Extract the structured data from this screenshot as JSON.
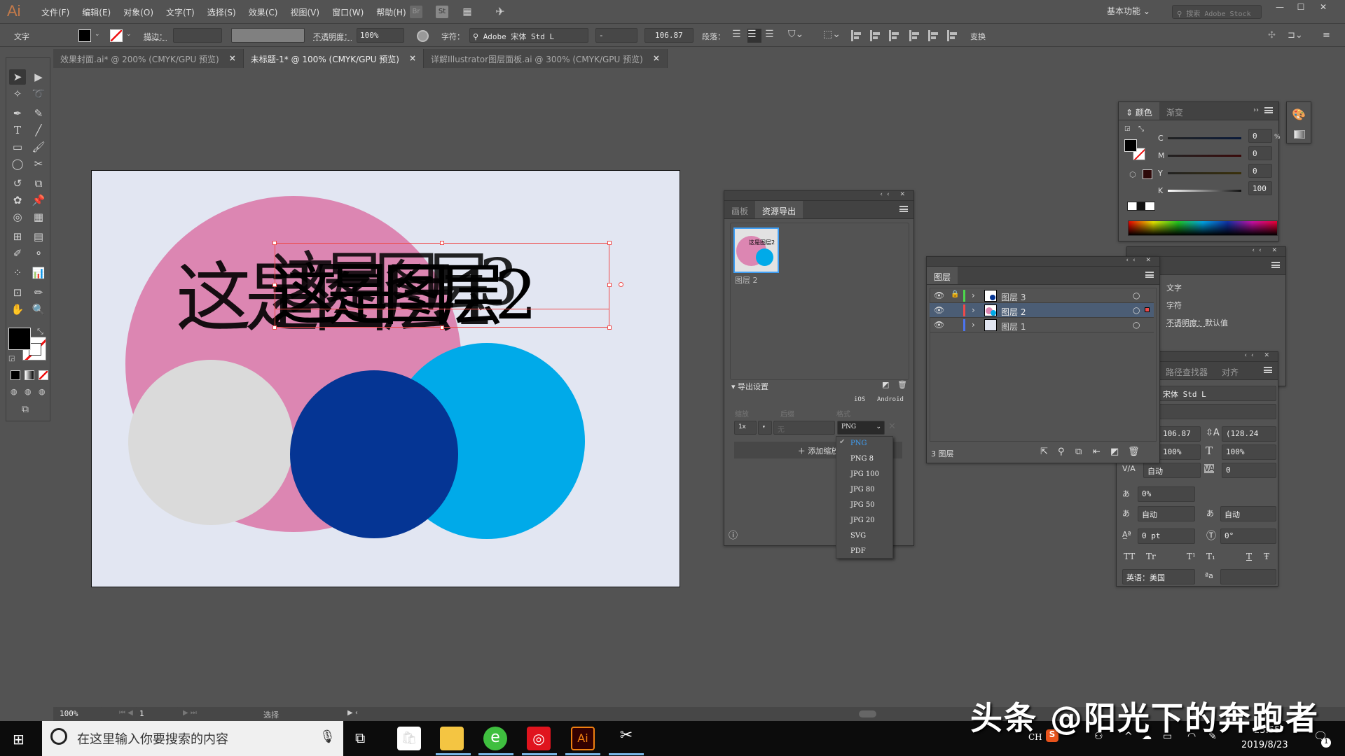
{
  "app": {
    "logo": "Ai",
    "menus": [
      "文件(F)",
      "编辑(E)",
      "对象(O)",
      "文字(T)",
      "选择(S)",
      "效果(C)",
      "视图(V)",
      "窗口(W)",
      "帮助(H)"
    ],
    "bridge_label": "Br",
    "stock_label": "St",
    "workspace": "基本功能",
    "stock_search_placeholder": "搜索 Adobe Stock",
    "window_controls": {
      "minimize": "—",
      "maximize": "☐",
      "close": "✕"
    }
  },
  "control_bar": {
    "tool_name": "文字",
    "stroke_label": "描边：",
    "opacity_label": "不透明度：",
    "opacity_value": "100%",
    "character_label": "字符：",
    "font_family": "Adobe 宋体 Std L",
    "font_style": "-",
    "font_size": "106.87",
    "paragraph_label": "段落：",
    "transform_label": "变换"
  },
  "tabs": [
    {
      "label": "效果封面.ai* @ 200% (CMYK/GPU 预览)",
      "active": false
    },
    {
      "label": "未标题-1* @ 100% (CMYK/GPU 预览)",
      "active": true
    },
    {
      "label": "详解Illustrator图层面板.ai @ 300% (CMYK/GPU 预览)",
      "active": false
    }
  ],
  "canvas": {
    "text_layer1": "这是图层1",
    "text_layer2": "这是图层2",
    "text_layer3": "这是图层3",
    "colors": {
      "pink": "#dc86b2",
      "gray": "#dadada",
      "navy": "#053594",
      "cyan": "#00aae9",
      "artboard": "#e2e6f2",
      "selection": "#ef4a4a"
    }
  },
  "asset_export": {
    "tabs": [
      "画板",
      "资源导出"
    ],
    "asset_label": "图层 2",
    "thumb_text": "这是图层2",
    "export_settings_label": "导出设置",
    "ios_label": "iOS",
    "android_label": "Android",
    "col_scale": "缩放",
    "col_suffix": "后缀",
    "col_format": "格式",
    "scale_value": "1x",
    "suffix_placeholder": "无",
    "format_value": "PNG",
    "add_scale_label": "添加缩放",
    "format_options": [
      "PNG",
      "PNG 8",
      "JPG 100",
      "JPG 80",
      "JPG 50",
      "JPG 20",
      "SVG",
      "PDF"
    ],
    "format_selected": "PNG"
  },
  "layers_panel": {
    "title": "图层",
    "layers": [
      {
        "name": "图层 3",
        "color": "#4cd84c",
        "locked": true,
        "selected": false
      },
      {
        "name": "图层 2",
        "color": "#ef4a4a",
        "locked": false,
        "selected": true
      },
      {
        "name": "图层 1",
        "color": "#4c74ef",
        "locked": false,
        "selected": false
      }
    ],
    "count_label": "3 图层"
  },
  "color_panel": {
    "tabs": [
      "颜色",
      "渐变"
    ],
    "channels": [
      {
        "label": "C",
        "value": "0"
      },
      {
        "label": "M",
        "value": "0"
      },
      {
        "label": "Y",
        "value": "0"
      },
      {
        "label": "K",
        "value": "100"
      }
    ],
    "unit": "%"
  },
  "properties_panel": {
    "items": [
      "文字",
      "字符"
    ],
    "opacity_label": "不透明度：",
    "opacity_value": "默认值"
  },
  "character_panel": {
    "tabs": [
      "路径查找器",
      "对齐"
    ],
    "font_family": "宋体 Std L",
    "font_size": "106.87",
    "leading": "(128.24",
    "vscale": "100%",
    "hscale": "100%",
    "kerning": "自动",
    "tracking": "0",
    "tsume": "0%",
    "aki_left": "自动",
    "aki_right": "自动",
    "baseline": "0 pt",
    "rotation": "0°",
    "type_styles": [
      "TT",
      "Tr",
      "T¹",
      "T₁",
      "T",
      "Ŧ"
    ],
    "language": "英语：美国"
  },
  "status_bar": {
    "zoom": "100%",
    "artboard_num": "1",
    "status": "选择"
  },
  "taskbar": {
    "search_placeholder": "在这里输入你要搜索的内容",
    "ime": "CH",
    "time": "23:55",
    "date": "2019/8/23",
    "notification_count": "1"
  },
  "watermark": "头条 @阳光下的奔跑者"
}
